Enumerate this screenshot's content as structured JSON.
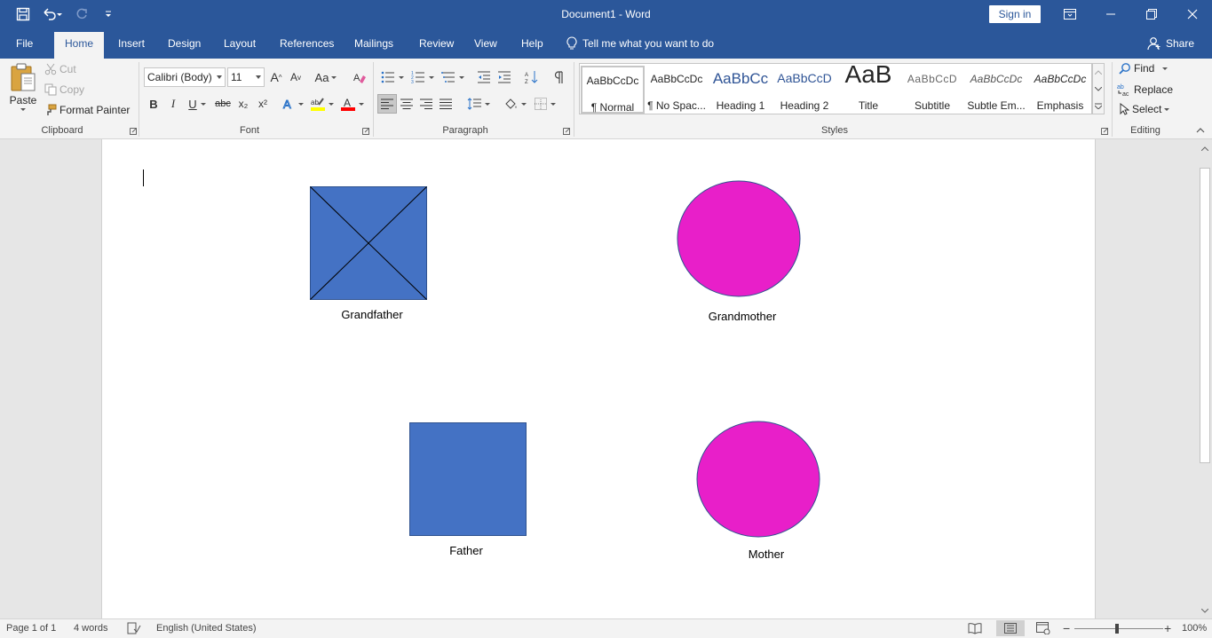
{
  "titlebar": {
    "title": "Document1 - Word",
    "sign_in": "Sign in"
  },
  "tabs": [
    {
      "label": "File"
    },
    {
      "label": "Home"
    },
    {
      "label": "Insert"
    },
    {
      "label": "Design"
    },
    {
      "label": "Layout"
    },
    {
      "label": "References"
    },
    {
      "label": "Mailings"
    },
    {
      "label": "Review"
    },
    {
      "label": "View"
    },
    {
      "label": "Help"
    }
  ],
  "tell_me": "Tell me what you want to do",
  "share": "Share",
  "clipboard": {
    "paste": "Paste",
    "cut": "Cut",
    "copy": "Copy",
    "format_painter": "Format Painter",
    "label": "Clipboard"
  },
  "font": {
    "name": "Calibri (Body)",
    "size": "11",
    "label": "Font",
    "bold": "B",
    "italic": "I",
    "underline": "U",
    "strike": "abc",
    "subscript": "x₂",
    "superscript": "x²",
    "grow": "A",
    "shrink": "A",
    "case": "Aa"
  },
  "paragraph": {
    "label": "Paragraph"
  },
  "styles": {
    "label": "Styles",
    "items": [
      {
        "preview": "AaBbCcDc",
        "name": "¶ Normal"
      },
      {
        "preview": "AaBbCcDc",
        "name": "¶ No Spac..."
      },
      {
        "preview": "AaBbCc",
        "name": "Heading 1"
      },
      {
        "preview": "AaBbCcD",
        "name": "Heading 2"
      },
      {
        "preview": "AaB",
        "name": "Title"
      },
      {
        "preview": "AaBbCcD",
        "name": "Subtitle"
      },
      {
        "preview": "AaBbCcDc",
        "name": "Subtle Em..."
      },
      {
        "preview": "AaBbCcDc",
        "name": "Emphasis"
      }
    ]
  },
  "editing": {
    "label": "Editing",
    "find": "Find",
    "replace": "Replace",
    "select": "Select"
  },
  "document": {
    "shapes": [
      {
        "label": "Grandfather",
        "kind": "crossed-square",
        "color": "#4472c4"
      },
      {
        "label": "Grandmother",
        "kind": "circle",
        "color": "#e81fc9"
      },
      {
        "label": "Father",
        "kind": "square",
        "color": "#4472c4"
      },
      {
        "label": "Mother",
        "kind": "circle",
        "color": "#e81fc9"
      }
    ]
  },
  "status": {
    "page": "Page 1 of 1",
    "words": "4 words",
    "language": "English (United States)",
    "zoom": "100%"
  },
  "colors": {
    "accent": "#2b579a",
    "highlight": "#ffff00",
    "font_color": "#ff0000"
  }
}
